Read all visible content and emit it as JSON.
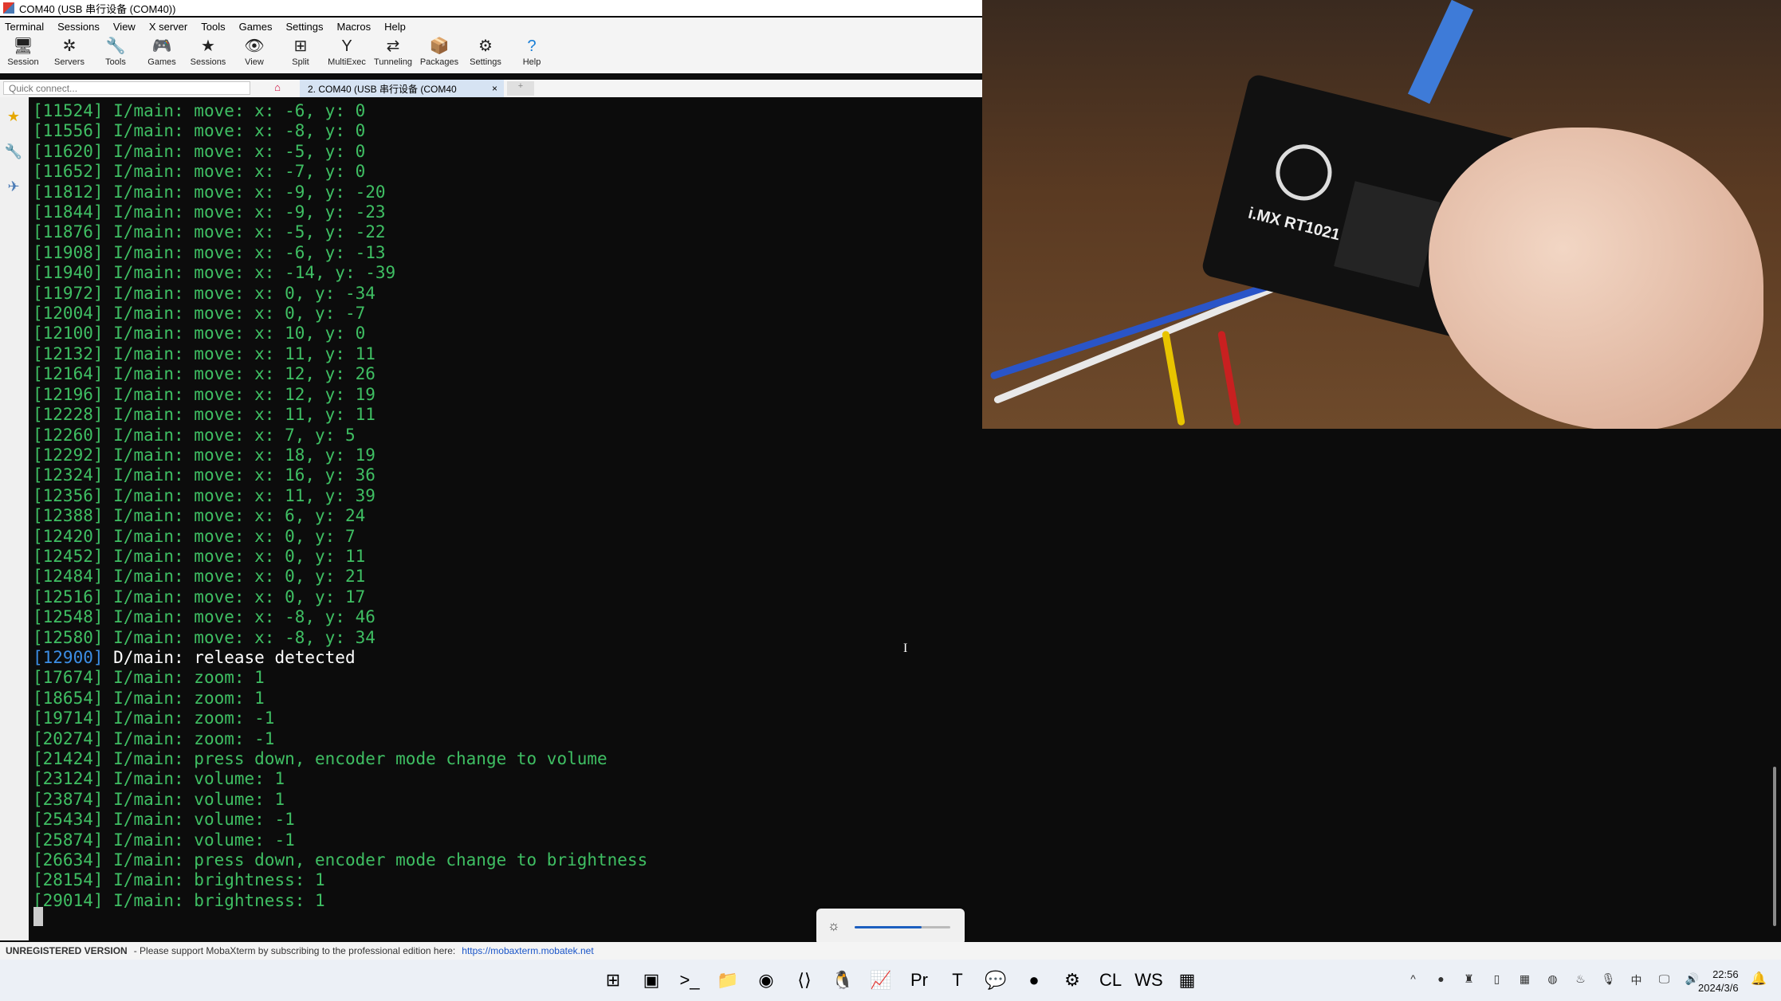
{
  "window": {
    "title": "COM40  (USB 串行设备 (COM40))"
  },
  "menu": [
    "Terminal",
    "Sessions",
    "View",
    "X server",
    "Tools",
    "Games",
    "Settings",
    "Macros",
    "Help"
  ],
  "toolbar": [
    {
      "label": "Session",
      "icon": "🖥"
    },
    {
      "label": "Servers",
      "icon": "✲"
    },
    {
      "label": "Tools",
      "icon": "🔧"
    },
    {
      "label": "Games",
      "icon": "🎮"
    },
    {
      "label": "Sessions",
      "icon": "★"
    },
    {
      "label": "View",
      "icon": "👁"
    },
    {
      "label": "Split",
      "icon": "⊞"
    },
    {
      "label": "MultiExec",
      "icon": "Y"
    },
    {
      "label": "Tunneling",
      "icon": "⇄"
    },
    {
      "label": "Packages",
      "icon": "📦"
    },
    {
      "label": "Settings",
      "icon": "⚙"
    },
    {
      "label": "Help",
      "icon": "?"
    }
  ],
  "tabs": {
    "quick_connect_placeholder": "Quick connect...",
    "active": "2. COM40  (USB 串行设备 (COM40",
    "home_icon": "⌂",
    "close": "×",
    "new_tab_icon": "+"
  },
  "sidebar_icons": [
    "★",
    "🔧",
    "✈"
  ],
  "terminal": {
    "lines": [
      {
        "ts": "[11524]",
        "text": " I/main: move: x: -6, y: 0"
      },
      {
        "ts": "[11556]",
        "text": " I/main: move: x: -8, y: 0"
      },
      {
        "ts": "[11620]",
        "text": " I/main: move: x: -5, y: 0"
      },
      {
        "ts": "[11652]",
        "text": " I/main: move: x: -7, y: 0"
      },
      {
        "ts": "[11812]",
        "text": " I/main: move: x: -9, y: -20"
      },
      {
        "ts": "[11844]",
        "text": " I/main: move: x: -9, y: -23"
      },
      {
        "ts": "[11876]",
        "text": " I/main: move: x: -5, y: -22"
      },
      {
        "ts": "[11908]",
        "text": " I/main: move: x: -6, y: -13"
      },
      {
        "ts": "[11940]",
        "text": " I/main: move: x: -14, y: -39"
      },
      {
        "ts": "[11972]",
        "text": " I/main: move: x: 0, y: -34"
      },
      {
        "ts": "[12004]",
        "text": " I/main: move: x: 0, y: -7"
      },
      {
        "ts": "[12100]",
        "text": " I/main: move: x: 10, y: 0"
      },
      {
        "ts": "[12132]",
        "text": " I/main: move: x: 11, y: 11"
      },
      {
        "ts": "[12164]",
        "text": " I/main: move: x: 12, y: 26"
      },
      {
        "ts": "[12196]",
        "text": " I/main: move: x: 12, y: 19"
      },
      {
        "ts": "[12228]",
        "text": " I/main: move: x: 11, y: 11"
      },
      {
        "ts": "[12260]",
        "text": " I/main: move: x: 7, y: 5"
      },
      {
        "ts": "[12292]",
        "text": " I/main: move: x: 18, y: 19"
      },
      {
        "ts": "[12324]",
        "text": " I/main: move: x: 16, y: 36"
      },
      {
        "ts": "[12356]",
        "text": " I/main: move: x: 11, y: 39"
      },
      {
        "ts": "[12388]",
        "text": " I/main: move: x: 6, y: 24"
      },
      {
        "ts": "[12420]",
        "text": " I/main: move: x: 0, y: 7"
      },
      {
        "ts": "[12452]",
        "text": " I/main: move: x: 0, y: 11"
      },
      {
        "ts": "[12484]",
        "text": " I/main: move: x: 0, y: 21"
      },
      {
        "ts": "[12516]",
        "text": " I/main: move: x: 0, y: 17"
      },
      {
        "ts": "[12548]",
        "text": " I/main: move: x: -8, y: 46"
      },
      {
        "ts": "[12580]",
        "text": " I/main: move: x: -8, y: 34"
      },
      {
        "ts": "[12900]",
        "text": " D/main: release detected",
        "level": "debug"
      },
      {
        "ts": "[17674]",
        "text": " I/main: zoom: 1"
      },
      {
        "ts": "[18654]",
        "text": " I/main: zoom: 1"
      },
      {
        "ts": "[19714]",
        "text": " I/main: zoom: -1"
      },
      {
        "ts": "[20274]",
        "text": " I/main: zoom: -1"
      },
      {
        "ts": "[21424]",
        "text": " I/main: press down, encoder mode change to volume"
      },
      {
        "ts": "[23124]",
        "text": " I/main: volume: 1"
      },
      {
        "ts": "[23874]",
        "text": " I/main: volume: 1"
      },
      {
        "ts": "[25434]",
        "text": " I/main: volume: -1"
      },
      {
        "ts": "[25874]",
        "text": " I/main: volume: -1"
      },
      {
        "ts": "[26634]",
        "text": " I/main: press down, encoder mode change to brightness"
      },
      {
        "ts": "[28154]",
        "text": " I/main: brightness: 1"
      },
      {
        "ts": "[29014]",
        "text": " I/main: brightness: 1"
      }
    ],
    "text_color": "#3fbf63",
    "debug_ts_color": "#3c8ee6"
  },
  "camera": {
    "board_text": "i.MX RT1021"
  },
  "brightness_osd": {
    "icon": "☼",
    "level_fraction": 0.7
  },
  "statusbar": {
    "registration": "UNREGISTERED VERSION",
    "message": "-  Please support MobaXterm by subscribing to the professional edition here:",
    "link": "https://mobaxterm.mobatek.net"
  },
  "taskbar": {
    "icons": [
      {
        "name": "start-icon",
        "glyph": "⊞"
      },
      {
        "name": "task-view-icon",
        "glyph": "▣"
      },
      {
        "name": "terminal-icon",
        "glyph": ">_"
      },
      {
        "name": "file-explorer-icon",
        "glyph": "📁"
      },
      {
        "name": "edge-icon",
        "glyph": "◉"
      },
      {
        "name": "vscode-icon",
        "glyph": "⟨⟩"
      },
      {
        "name": "qq-icon",
        "glyph": "🐧"
      },
      {
        "name": "monitor-icon",
        "glyph": "📈"
      },
      {
        "name": "premiere-icon",
        "glyph": "Pr"
      },
      {
        "name": "typora-icon",
        "glyph": "T"
      },
      {
        "name": "wechat-icon",
        "glyph": "💬"
      },
      {
        "name": "app-icon",
        "glyph": "●"
      },
      {
        "name": "settings-icon",
        "glyph": "⚙"
      },
      {
        "name": "clion-icon",
        "glyph": "CL"
      },
      {
        "name": "webstorm-icon",
        "glyph": "WS"
      },
      {
        "name": "mobaxterm-icon",
        "glyph": "▦"
      }
    ],
    "tray": [
      "^",
      "●",
      "♜",
      "▯",
      "▦",
      "◍",
      "♨",
      "🎙",
      "中",
      "🖵",
      "🔊"
    ],
    "time": "22:56",
    "date": "2024/3/6",
    "bell": "🔔"
  }
}
